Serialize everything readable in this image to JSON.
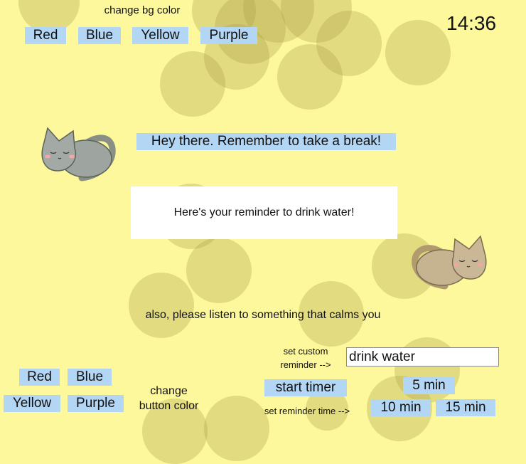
{
  "clock": {
    "time": "14:36"
  },
  "bg_color": {
    "title": "change bg color",
    "buttons": [
      "Red",
      "Blue",
      "Yellow",
      "Purple"
    ]
  },
  "break_message": "Hey there. Remember to take a break!",
  "reminder_message": "Here's your reminder to drink water!",
  "calm_message": "also, please listen to something that calms you",
  "button_color": {
    "label_line1": "change",
    "label_line2": "button color",
    "buttons": [
      "Red",
      "Blue",
      "Yellow",
      "Purple"
    ]
  },
  "custom_reminder": {
    "label_line1": "set custom",
    "label_line2": "reminder -->",
    "value": "drink water"
  },
  "timer": {
    "start_label": "start timer",
    "set_time_label": "set reminder time -->",
    "options": [
      "5 min",
      "10 min",
      "15 min"
    ]
  },
  "colors": {
    "background": "#fdf89b",
    "button": "#b3d6f5"
  }
}
